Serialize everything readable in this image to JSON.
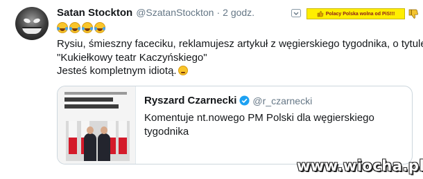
{
  "tweet": {
    "author_name": "Satan Stockton",
    "handle": "@SzatanStockton",
    "separator": "·",
    "time": "2 godz.",
    "emojis": [
      "joy-emoji",
      "joy-emoji",
      "joy-emoji",
      "joy-emoji"
    ],
    "text_line1": "Rysiu, śmieszny faceciku, reklamujesz artykuł z węgierskiego tygodnika, o tytule",
    "text_line2": "\"Kukiełkowy teatr Kaczyńskiego\"",
    "text_line3": "Jesteś kompletnym idiotą.",
    "wink_icon": "winking-face-emoji"
  },
  "banner": {
    "text": "Polacy Polska wolna od PiS!!!",
    "bg_color": "#ffee00"
  },
  "quoted": {
    "author_name": "Ryszard Czarnecki",
    "verified": true,
    "handle": "@r_czarnecki",
    "text_line1": "Komentuje nt.nowego PM Polski dla węgierskiego",
    "text_line2": "tygodnika"
  },
  "watermark": "www.wiocha.pl",
  "colors": {
    "text": "#14171a",
    "secondary": "#657786",
    "border": "#ccd6dd",
    "verified": "#1da1f2"
  }
}
